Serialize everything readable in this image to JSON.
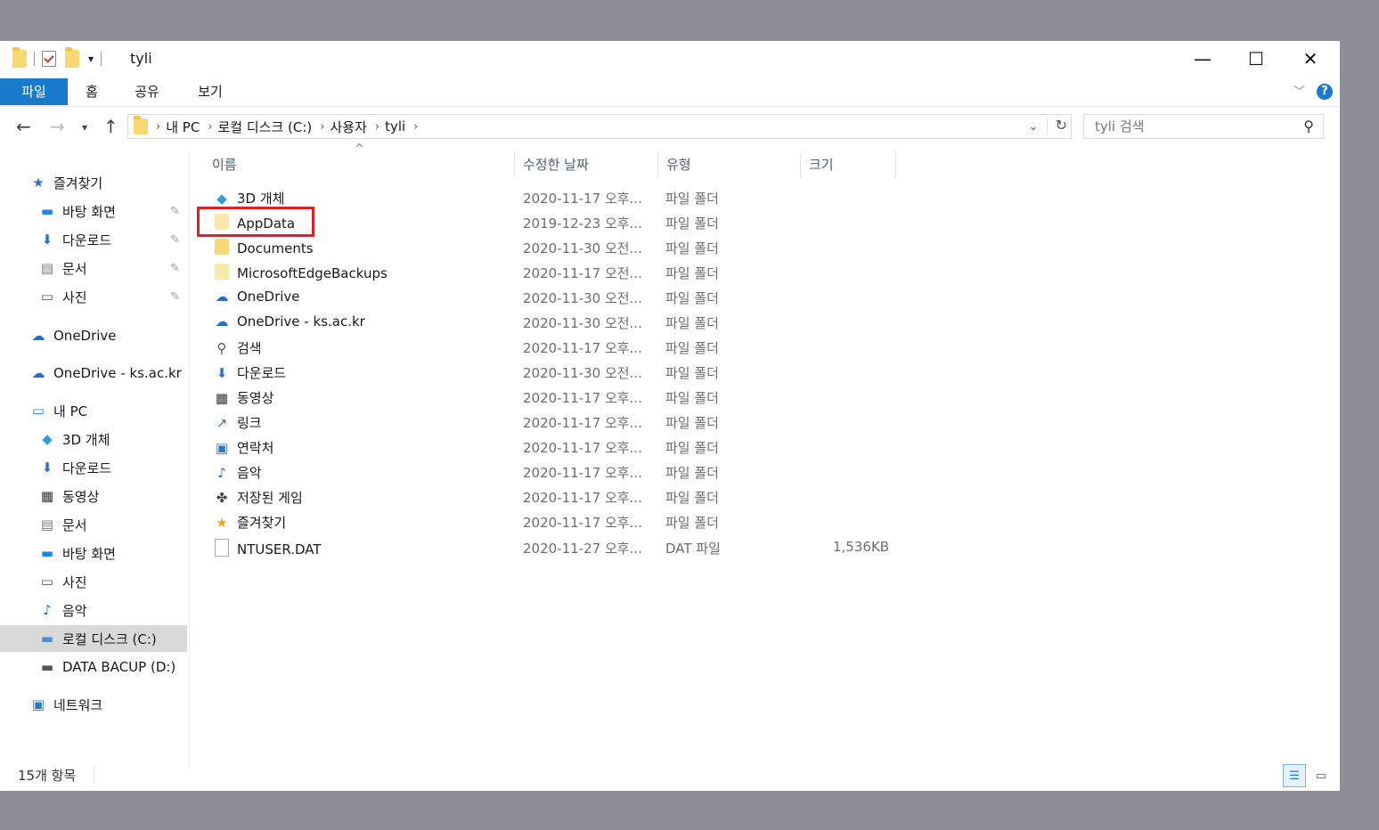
{
  "window": {
    "title": "tyli",
    "controls": {
      "minimize": "—",
      "maximize": "☐",
      "close": "✕"
    }
  },
  "ribbon": {
    "tabs": [
      "파일",
      "홈",
      "공유",
      "보기"
    ]
  },
  "address": {
    "breadcrumb": [
      "내 PC",
      "로컬 디스크 (C:)",
      "사용자",
      "tyli"
    ],
    "search_placeholder": "tyli 검색"
  },
  "navpane": {
    "items": [
      {
        "label": "즐겨찾기",
        "icon": "star-icon",
        "glyph": "★",
        "color": "#2a74c9"
      },
      {
        "label": "바탕 화면",
        "icon": "desktop-icon",
        "glyph": "▬",
        "color": "#1e88e5",
        "pinned": true
      },
      {
        "label": "다운로드",
        "icon": "download-icon",
        "glyph": "⬇",
        "color": "#2a74c9",
        "pinned": true
      },
      {
        "label": "문서",
        "icon": "document-icon",
        "glyph": "▤",
        "color": "#777",
        "pinned": true
      },
      {
        "label": "사진",
        "icon": "picture-icon",
        "glyph": "▭",
        "color": "#555",
        "pinned": true
      },
      {
        "label": "OneDrive",
        "icon": "cloud-icon",
        "glyph": "☁",
        "color": "#1e6fcf"
      },
      {
        "label": "OneDrive - ks.ac.kr",
        "icon": "cloud-icon",
        "glyph": "☁",
        "color": "#1e6fcf"
      },
      {
        "label": "내 PC",
        "icon": "computer-icon",
        "glyph": "▭",
        "color": "#1e88e5"
      },
      {
        "label": "3D 개체",
        "icon": "cube-icon",
        "glyph": "◆",
        "color": "#2d9cdb"
      },
      {
        "label": "다운로드",
        "icon": "download-icon",
        "glyph": "⬇",
        "color": "#2a74c9"
      },
      {
        "label": "동영상",
        "icon": "film-icon",
        "glyph": "▦",
        "color": "#333"
      },
      {
        "label": "문서",
        "icon": "document-icon",
        "glyph": "▤",
        "color": "#777"
      },
      {
        "label": "바탕 화면",
        "icon": "desktop-icon",
        "glyph": "▬",
        "color": "#1e88e5"
      },
      {
        "label": "사진",
        "icon": "picture-icon",
        "glyph": "▭",
        "color": "#555"
      },
      {
        "label": "음악",
        "icon": "music-icon",
        "glyph": "♪",
        "color": "#1e6fcf"
      },
      {
        "label": "로컬 디스크 (C:)",
        "icon": "drive-icon",
        "glyph": "▬",
        "color": "#4a90d9",
        "selected": true
      },
      {
        "label": "DATA BACUP (D:)",
        "icon": "drive-icon",
        "glyph": "▬",
        "color": "#555"
      },
      {
        "label": "네트워크",
        "icon": "network-icon",
        "glyph": "▣",
        "color": "#2a74c9"
      }
    ]
  },
  "columns": {
    "name": "이름",
    "date": "수정한 날짜",
    "type": "유형",
    "size": "크기"
  },
  "files": [
    {
      "name": "3D 개체",
      "date": "2020-11-17 오후...",
      "type": "파일 폴더",
      "size": "",
      "icon": "cube-icon"
    },
    {
      "name": "AppData",
      "date": "2019-12-23 오후...",
      "type": "파일 폴더",
      "size": "",
      "icon": "folder-icon",
      "highlighted": true
    },
    {
      "name": "Documents",
      "date": "2020-11-30 오전...",
      "type": "파일 폴더",
      "size": "",
      "icon": "folder-icon"
    },
    {
      "name": "MicrosoftEdgeBackups",
      "date": "2020-11-17 오전...",
      "type": "파일 폴더",
      "size": "",
      "icon": "folder-icon"
    },
    {
      "name": "OneDrive",
      "date": "2020-11-30 오전...",
      "type": "파일 폴더",
      "size": "",
      "icon": "cloud-icon"
    },
    {
      "name": "OneDrive - ks.ac.kr",
      "date": "2020-11-30 오전...",
      "type": "파일 폴더",
      "size": "",
      "icon": "cloud-icon"
    },
    {
      "name": "검색",
      "date": "2020-11-17 오후...",
      "type": "파일 폴더",
      "size": "",
      "icon": "search-icon"
    },
    {
      "name": "다운로드",
      "date": "2020-11-30 오전...",
      "type": "파일 폴더",
      "size": "",
      "icon": "download-icon"
    },
    {
      "name": "동영상",
      "date": "2020-11-17 오후...",
      "type": "파일 폴더",
      "size": "",
      "icon": "film-icon"
    },
    {
      "name": "링크",
      "date": "2020-11-17 오후...",
      "type": "파일 폴더",
      "size": "",
      "icon": "link-icon"
    },
    {
      "name": "연락처",
      "date": "2020-11-17 오후...",
      "type": "파일 폴더",
      "size": "",
      "icon": "contacts-icon"
    },
    {
      "name": "음악",
      "date": "2020-11-17 오후...",
      "type": "파일 폴더",
      "size": "",
      "icon": "music-icon"
    },
    {
      "name": "저장된 게임",
      "date": "2020-11-17 오후...",
      "type": "파일 폴더",
      "size": "",
      "icon": "game-icon"
    },
    {
      "name": "즐겨찾기",
      "date": "2020-11-17 오후...",
      "type": "파일 폴더",
      "size": "",
      "icon": "star-icon"
    },
    {
      "name": "NTUSER.DAT",
      "date": "2020-11-27 오후...",
      "type": "DAT 파일",
      "size": "1,536KB",
      "icon": "file-icon"
    }
  ],
  "status": {
    "item_count": "15개 항목"
  },
  "colors": {
    "accent": "#1979ca",
    "highlight_border": "#e02020",
    "selected_nav": "#d9d9d9"
  }
}
